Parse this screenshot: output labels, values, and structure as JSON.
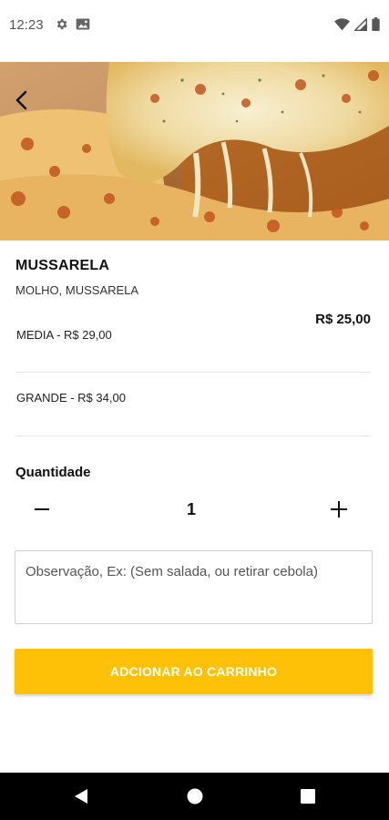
{
  "status_bar": {
    "time": "12:23",
    "icons": [
      "settings-gear-icon",
      "photo-icon",
      "wifi-icon",
      "signal-icon",
      "battery-icon"
    ]
  },
  "header": {
    "back_icon": "chevron-left-icon"
  },
  "product": {
    "name": "MUSSARELA",
    "description": "MOLHO, MUSSARELA",
    "price": "R$ 25,00"
  },
  "sizes": [
    {
      "label": "MEDIA - R$ 29,00"
    },
    {
      "label": "GRANDE - R$ 34,00"
    }
  ],
  "quantity": {
    "title": "Quantidade",
    "value": "1",
    "minus_icon": "minus-icon",
    "plus_icon": "plus-icon"
  },
  "notes": {
    "placeholder": "Observação, Ex: (Sem salada, ou retirar cebola)",
    "value": ""
  },
  "actions": {
    "add_to_cart_label": "ADCIONAR AO CARRINHO"
  },
  "colors": {
    "accent": "#FFC107",
    "text": "#111111",
    "divider": "#E6E6E6",
    "nav_bar": "#000000"
  },
  "nav_bar": {
    "icons": [
      "nav-back-icon",
      "nav-home-icon",
      "nav-recents-icon"
    ]
  }
}
